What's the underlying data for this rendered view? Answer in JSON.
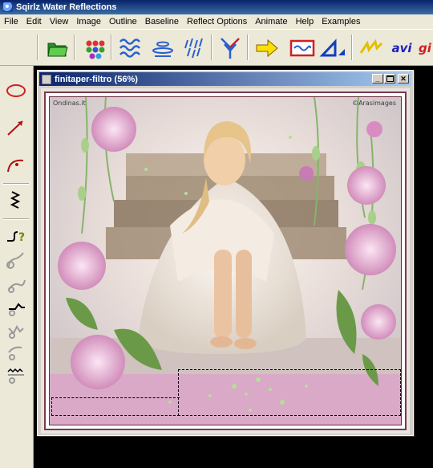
{
  "app": {
    "title": "Sqirlz Water Reflections"
  },
  "menu": [
    "File",
    "Edit",
    "View",
    "Image",
    "Outline",
    "Baseline",
    "Reflect Options",
    "Animate",
    "Help",
    "Examples"
  ],
  "toolbar": {
    "buttons": [
      {
        "name": "open-folder-icon"
      },
      {
        "name": "color-dots-icon"
      },
      {
        "name": "ripples-icon"
      },
      {
        "name": "waves-icon"
      },
      {
        "name": "rain-icon"
      },
      {
        "name": "branch-icon"
      },
      {
        "name": "arrow-right-icon"
      },
      {
        "name": "red-frame-icon"
      },
      {
        "name": "triangle-icon"
      },
      {
        "name": "lightning-icon"
      }
    ],
    "avi_label": "avi",
    "gif_label": "gi"
  },
  "palette": {
    "tools": [
      "ellipse-tool-icon",
      "line-tool-icon",
      "curve-tool-icon",
      "zigzag-tool-icon",
      "help-tool-icon",
      "lasso-tool-icon-1",
      "lasso-tool-icon-2",
      "lasso-tool-icon-3",
      "lasso-tool-icon-4",
      "lasso-tool-icon-5",
      "lasso-tool-icon-6"
    ]
  },
  "document": {
    "title": "finitaper-filtro  (56%)",
    "watermark_left": "Ondinas.it",
    "watermark_right": "©Arasimages"
  },
  "colors": {
    "title_start": "#0a246a",
    "title_end": "#3a6ea5",
    "ui_face": "#ece9d8",
    "frame": "#7a3a4a",
    "flower_pink": "#e7a3cf",
    "leaf_green": "#6a9a48"
  }
}
